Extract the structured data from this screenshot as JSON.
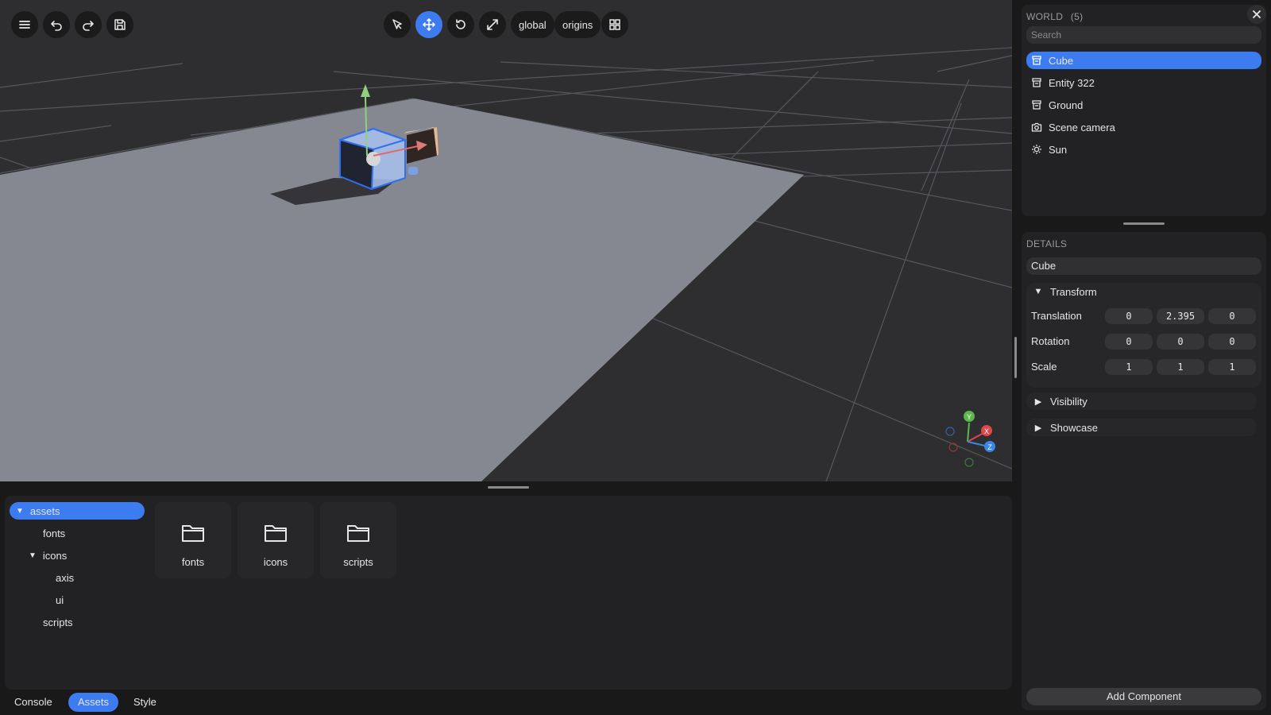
{
  "toolbar": {
    "left_icons": [
      "menu-icon",
      "undo-icon",
      "redo-icon",
      "save-icon"
    ],
    "center_icons": [
      "select-cursor-icon",
      "move-icon",
      "rotate-icon",
      "scale-icon"
    ],
    "space_label": "global",
    "pivot_label": "origins",
    "grid_icon": "grid-icon"
  },
  "world": {
    "title": "WORLD",
    "count": "(5)",
    "search_placeholder": "Search",
    "items": [
      {
        "label": "Cube",
        "icon": "entity-icon",
        "selected": true
      },
      {
        "label": "Entity 322",
        "icon": "entity-icon",
        "selected": false
      },
      {
        "label": "Ground",
        "icon": "entity-icon",
        "selected": false
      },
      {
        "label": "Scene camera",
        "icon": "camera-icon",
        "selected": false
      },
      {
        "label": "Sun",
        "icon": "sun-icon",
        "selected": false
      }
    ]
  },
  "details": {
    "title": "DETAILS",
    "name_value": "Cube",
    "transform": {
      "label": "Transform",
      "translation_label": "Translation",
      "translation": [
        "0",
        "2.395",
        "0"
      ],
      "rotation_label": "Rotation",
      "rotation": [
        "0",
        "0",
        "0"
      ],
      "scale_label": "Scale",
      "scale": [
        "1",
        "1",
        "1"
      ]
    },
    "visibility_label": "Visibility",
    "showcase_label": "Showcase",
    "add_component_label": "Add Component"
  },
  "axis_gizmo": {
    "x": "X",
    "y": "Y",
    "z": "Z"
  },
  "assets_tree": {
    "root": "assets",
    "fonts": "fonts",
    "icons": "icons",
    "axis": "axis",
    "ui": "ui",
    "scripts": "scripts"
  },
  "folders": [
    "fonts",
    "icons",
    "scripts"
  ],
  "tabs": [
    {
      "label": "Console",
      "active": false
    },
    {
      "label": "Assets",
      "active": true
    },
    {
      "label": "Style",
      "active": false
    }
  ],
  "colors": {
    "accent": "#3d7bf0",
    "panel": "#222224",
    "viewport": "#2e2e30",
    "ground": "#868891",
    "axis_x": "#e0474c",
    "axis_y": "#5db84c",
    "axis_z": "#3a87e6"
  }
}
